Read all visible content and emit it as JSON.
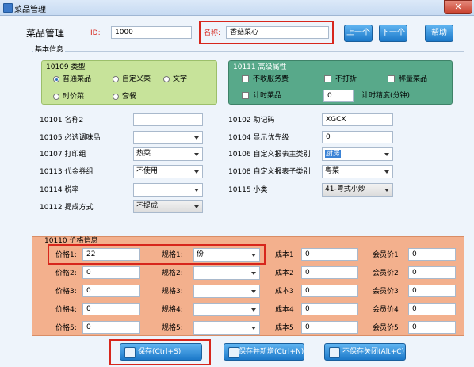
{
  "window": {
    "title": "菜品管理",
    "close": "✕"
  },
  "header": {
    "heading": "菜品管理",
    "id_label": "ID:",
    "id_value": "1000",
    "name_label": "名称:",
    "name_value": "香菇菜心",
    "prev_button": "上一个",
    "next_button": "下一个",
    "help_button": "帮助"
  },
  "basic": {
    "legend": "基本信息",
    "type_group": {
      "title": "10109 类型",
      "options": [
        "普通菜品",
        "自定义菜",
        "文字",
        "时价菜",
        "套餐"
      ],
      "selected": "普通菜品"
    },
    "adv_group": {
      "title": "10111 高级属性",
      "no_service_fee": "不收服务费",
      "no_discount": "不打折",
      "weigh_item": "称量菜品",
      "timed_item": "计时菜品",
      "time_precision_value": "0",
      "time_precision_label": "计时精度(分钟)"
    },
    "fields": {
      "name2_label": "10101 名称2",
      "name2_value": "",
      "mnemonic_label": "10102 助记码",
      "mnemonic_value": "XGCX",
      "seasoning_label": "10105 必选调味品",
      "seasoning_value": "",
      "priority_label": "10104 显示优先级",
      "priority_value": "0",
      "print_group_label": "10107 打印组",
      "print_group_value": "热菜",
      "report_main_label": "10106 自定义报表主类别",
      "report_main_value": "厨房",
      "voucher_group_label": "10113 代金券组",
      "voucher_group_value": "不使用",
      "report_sub_label": "10108 自定义报表子类别",
      "report_sub_value": "粤菜",
      "tax_label": "10114 税率",
      "tax_value": "",
      "subclass_label": "10115 小类",
      "subclass_value": "41-粤式小炒",
      "commission_label": "10112 提成方式",
      "commission_value": "不提成"
    }
  },
  "price": {
    "title": "10110 价格信息",
    "rows": [
      {
        "price_label": "价格1:",
        "price_value": "22",
        "spec_label": "规格1:",
        "spec_value": "份",
        "cost_label": "成本1",
        "cost_value": "0",
        "member_label": "会员价1",
        "member_value": "0"
      },
      {
        "price_label": "价格2:",
        "price_value": "0",
        "spec_label": "规格2:",
        "spec_value": "",
        "cost_label": "成本2",
        "cost_value": "0",
        "member_label": "会员价2",
        "member_value": "0"
      },
      {
        "price_label": "价格3:",
        "price_value": "0",
        "spec_label": "规格3:",
        "spec_value": "",
        "cost_label": "成本3",
        "cost_value": "0",
        "member_label": "会员价3",
        "member_value": "0"
      },
      {
        "price_label": "价格4:",
        "price_value": "0",
        "spec_label": "规格4:",
        "spec_value": "",
        "cost_label": "成本4",
        "cost_value": "0",
        "member_label": "会员价4",
        "member_value": "0"
      },
      {
        "price_label": "价格5:",
        "price_value": "0",
        "spec_label": "规格5:",
        "spec_value": "",
        "cost_label": "成本5",
        "cost_value": "0",
        "member_label": "会员价5",
        "member_value": "0"
      }
    ]
  },
  "footer": {
    "save": "保存(Ctrl+S)",
    "save_new": "保存并新增(Ctrl+N)",
    "close_nosave": "不保存关闭(Alt+C)"
  },
  "colors": {
    "type_group_bg": "#c7e39a",
    "adv_group_bg": "#58a98a",
    "price_bg": "#f3b08d",
    "accent_red": "#d7261c",
    "button_blue": "#1c79c9"
  }
}
